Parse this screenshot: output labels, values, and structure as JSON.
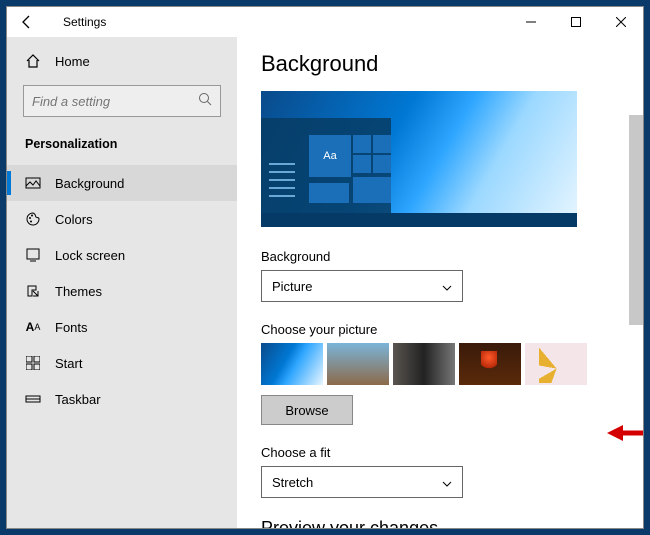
{
  "window": {
    "title": "Settings"
  },
  "sidebar": {
    "home": "Home",
    "search_placeholder": "Find a setting",
    "section": "Personalization",
    "items": [
      {
        "label": "Background"
      },
      {
        "label": "Colors"
      },
      {
        "label": "Lock screen"
      },
      {
        "label": "Themes"
      },
      {
        "label": "Fonts"
      },
      {
        "label": "Start"
      },
      {
        "label": "Taskbar"
      }
    ]
  },
  "main": {
    "heading": "Background",
    "preview_text": "Aa",
    "bg_label": "Background",
    "bg_value": "Picture",
    "choose_label": "Choose your picture",
    "browse": "Browse",
    "fit_label": "Choose a fit",
    "fit_value": "Stretch",
    "preview_heading": "Preview your changes"
  }
}
